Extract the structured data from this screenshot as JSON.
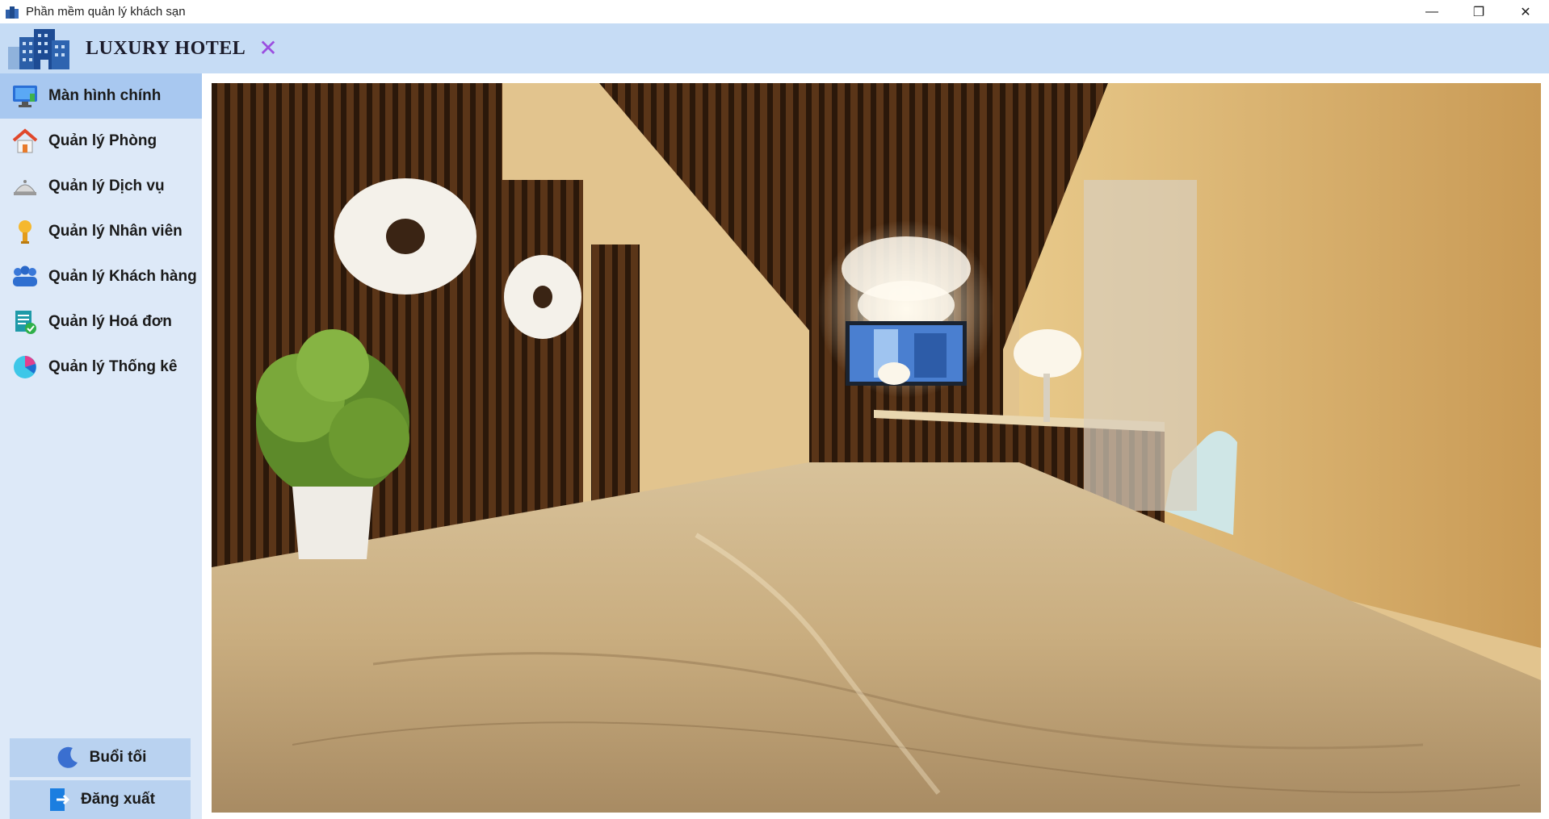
{
  "window": {
    "title": "Phần mềm quản lý khách sạn",
    "controls": {
      "minimize": "—",
      "restore": "❐",
      "close": "✕"
    }
  },
  "header": {
    "brand": "LUXURY HOTEL",
    "close_glyph": "✕",
    "accent_color": "#9b4fe0"
  },
  "sidebar": {
    "items": [
      {
        "label": "Màn hình chính",
        "icon": "monitor-icon",
        "active": true
      },
      {
        "label": "Quản lý Phòng",
        "icon": "house-icon",
        "active": false
      },
      {
        "label": "Quản lý Dịch vụ",
        "icon": "service-bell-icon",
        "active": false
      },
      {
        "label": "Quản lý Nhân viên",
        "icon": "staff-icon",
        "active": false
      },
      {
        "label": "Quản lý Khách hàng",
        "icon": "customers-icon",
        "active": false
      },
      {
        "label": "Quản lý Hoá đơn",
        "icon": "invoice-icon",
        "active": false
      },
      {
        "label": "Quản lý Thống kê",
        "icon": "pie-chart-icon",
        "active": false
      }
    ],
    "night_mode_label": "Buổi tối",
    "logout_label": "Đăng xuất"
  },
  "colors": {
    "header_bg": "#c6dcf5",
    "sidebar_bg": "#dde9f8",
    "active_item_bg": "#a8c8f0",
    "button_bg": "#b9d2f0"
  },
  "main": {
    "image": "hotel-lobby-photo"
  }
}
